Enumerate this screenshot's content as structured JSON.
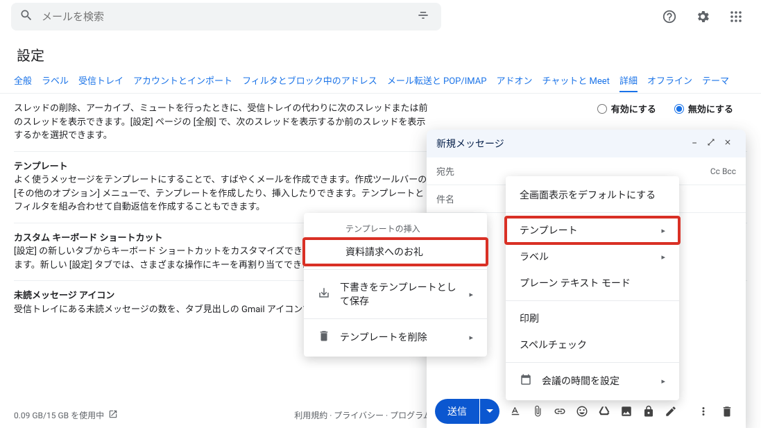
{
  "search": {
    "placeholder": "メールを検索"
  },
  "settings_title": "設定",
  "tabs": [
    "全般",
    "ラベル",
    "受信トレイ",
    "アカウントとインポート",
    "フィルタとブロック中のアドレス",
    "メール転送と POP/IMAP",
    "アドオン",
    "チャットと Meet",
    "詳細",
    "オフライン",
    "テーマ"
  ],
  "active_tab_index": 8,
  "rows": {
    "auto_advance": {
      "desc": "スレッドの削除、アーカイブ、ミュートを行ったときに、受信トレイの代わりに次のスレッドまたは前のスレッドを表示できます。[設定] ページの [全般] で、次のスレッドを表示するか前のスレッドを表示するかを選択できます。",
      "enable": "有効にする",
      "disable": "無効にする",
      "value": "disable"
    },
    "templates": {
      "title": "テンプレート",
      "desc": "よく使うメッセージをテンプレートにすることで、すばやくメールを作成できます。作成ツールバーの [その他のオプション] メニューで、テンプレートを作成したり、挿入したりできます。テンプレートとフィルタを組み合わせて自動返信を作成することもできます。"
    },
    "keyboard": {
      "title": "カスタム キーボード ショートカット",
      "desc": "[設定] の新しいタブからキーボード ショートカットをカスタマイズできる機能を有効にすることができます。新しい [設定] タブでは、さまざまな操作にキーを再割り当てできます。"
    },
    "unread_icon": {
      "title": "未読メッセージ アイコン",
      "desc": "受信トレイにある未読メッセージの数を、タブ見出しの Gmail アイコンで一目で確認できます。"
    }
  },
  "footer": {
    "storage": "0.09 GB/15 GB を使用中",
    "links": "利用規約 · プライバシー · プログラム ポリシー"
  },
  "compose": {
    "title": "新規メッセージ",
    "to": "宛先",
    "cc": "Cc",
    "bcc": "Bcc",
    "subject": "件名",
    "send": "送信"
  },
  "more_menu": {
    "fullscreen": "全画面表示をデフォルトにする",
    "templates": "テンプレート",
    "label": "ラベル",
    "plaintext": "プレーン テキスト モード",
    "print": "印刷",
    "spellcheck": "スペルチェック",
    "schedule": "会議の時間を設定"
  },
  "template_submenu": {
    "heading": "テンプレートの挿入",
    "insert_item": "資料請求へのお礼",
    "save_draft": "下書きをテンプレートとして保存",
    "delete": "テンプレートを削除"
  }
}
